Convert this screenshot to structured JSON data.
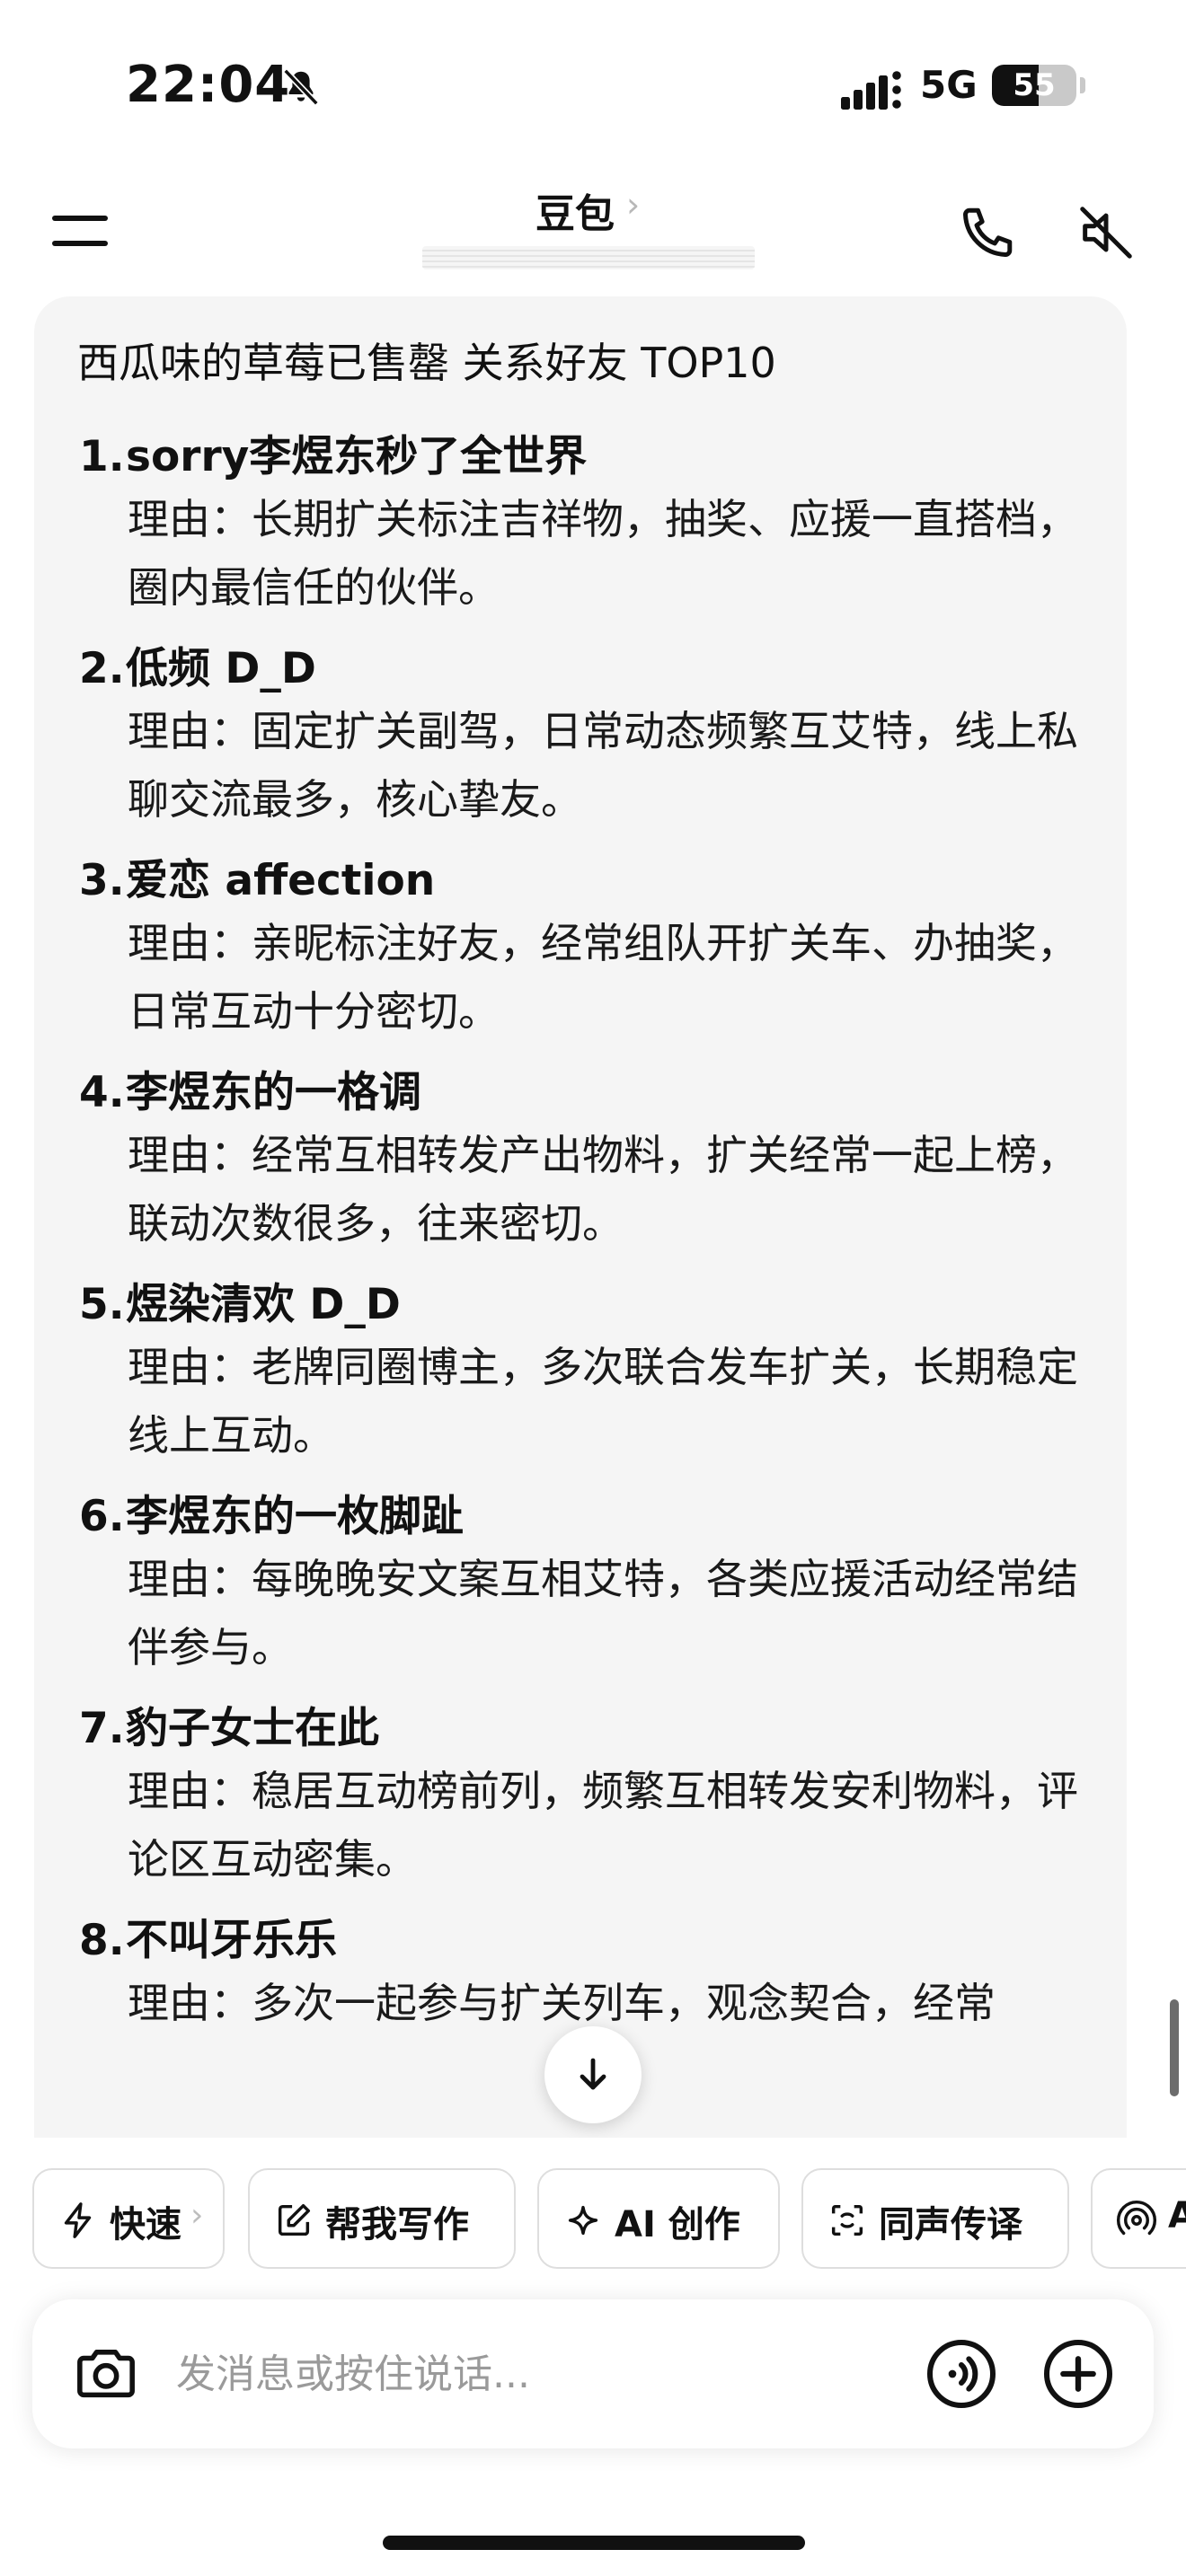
{
  "status_bar": {
    "time": "22:04",
    "network": "5G",
    "battery_level": "55",
    "battery_fraction": 0.55,
    "icons": [
      "bell-slash-icon",
      "cellular-signal-icon",
      "battery-icon"
    ]
  },
  "header": {
    "title": "豆包",
    "chevron": "›",
    "icons": [
      "menu-icon",
      "phone-icon",
      "speaker-mute-icon"
    ]
  },
  "message": {
    "heading": "西瓜味的草莓已售罄 关系好友 TOP10",
    "items": [
      {
        "num": "1.",
        "name": "sorry李煜东秒了全世界",
        "reason": "理由：长期扩关标注吉祥物，抽奖、应援一直搭档，圈内最信任的伙伴。"
      },
      {
        "num": "2.",
        "name": "低频 D_D",
        "reason": "理由：固定扩关副驾，日常动态频繁互艾特，线上私聊交流最多，核心挚友。"
      },
      {
        "num": "3.",
        "name": "爱恋 affection",
        "reason": "理由：亲昵标注好友，经常组队开扩关车、办抽奖，日常互动十分密切。"
      },
      {
        "num": "4.",
        "name": "李煜东的一格调",
        "reason": "理由：经常互相转发产出物料，扩关经常一起上榜，联动次数很多，往来密切。"
      },
      {
        "num": "5.",
        "name": "煜染清欢 D_D",
        "reason": "理由：老牌同圈博主，多次联合发车扩关，长期稳定线上互动。"
      },
      {
        "num": "6.",
        "name": "李煜东的一枚脚趾",
        "reason": "理由：每晚晚安文案互相艾特，各类应援活动经常结伴参与。"
      },
      {
        "num": "7.",
        "name": "豹子女士在此",
        "reason": "理由：稳居互动榜前列，频繁互相转发安利物料，评论区互动密集。"
      },
      {
        "num": "8.",
        "name": "不叫牙乐乐",
        "reason": "理由：多次一起参与扩关列车，观念契合，经常"
      }
    ]
  },
  "chips": [
    {
      "label": "快速",
      "icon": "lightning-icon",
      "chevron": "›"
    },
    {
      "label": "帮我写作",
      "icon": "edit-icon"
    },
    {
      "label": "AI 创作",
      "icon": "sparkle-icon"
    },
    {
      "label": "同声传译",
      "icon": "interpret-icon"
    },
    {
      "label": "A",
      "icon": "broadcast-icon"
    }
  ],
  "composer": {
    "placeholder": "发消息或按住说话..."
  }
}
